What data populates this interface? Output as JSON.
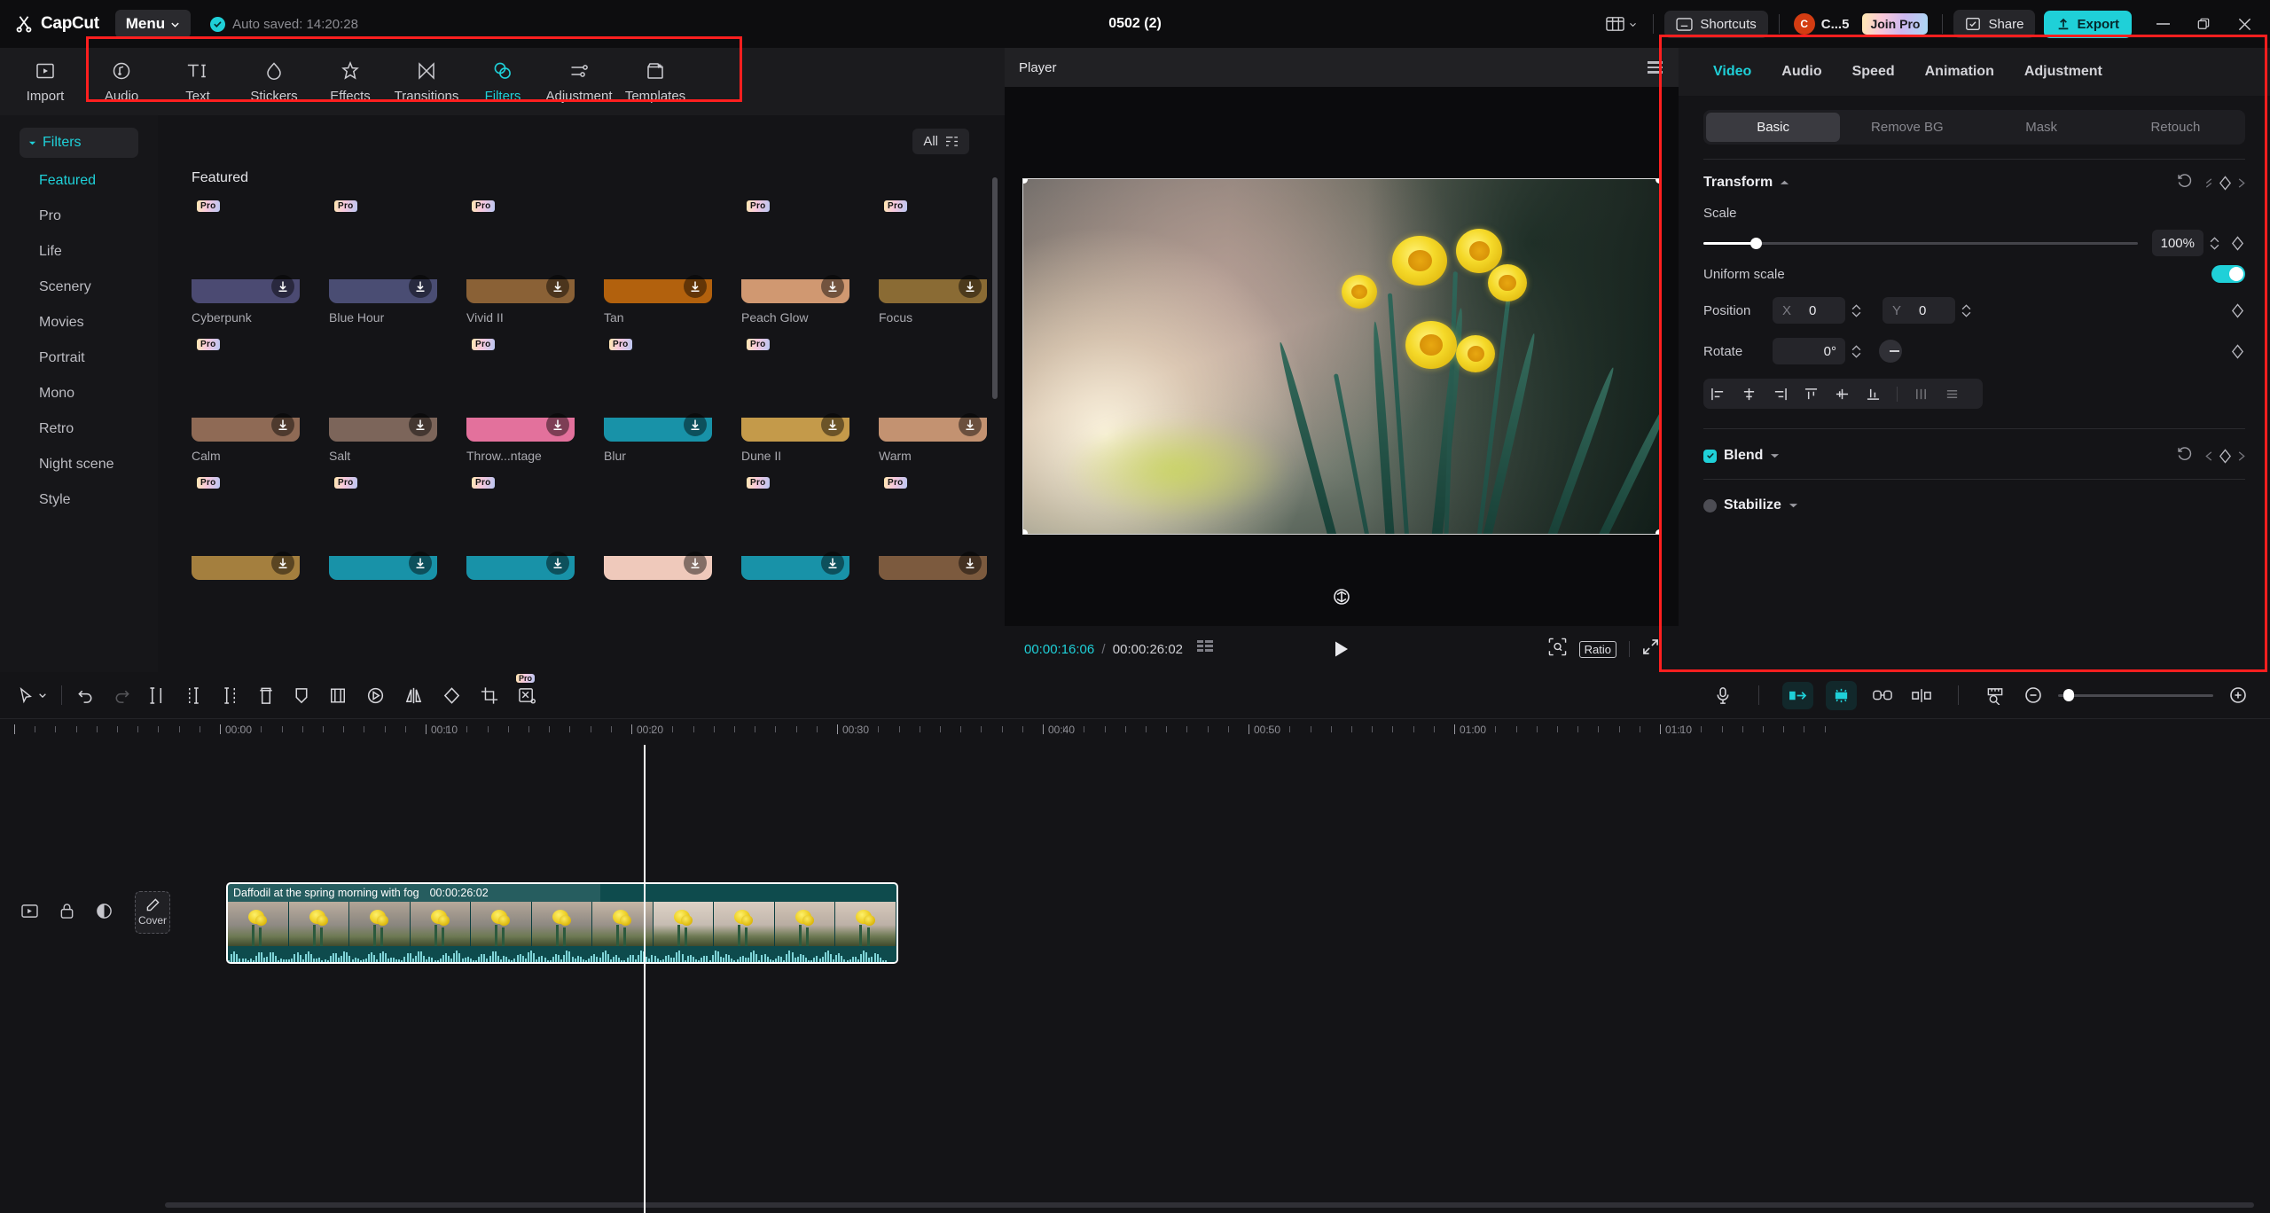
{
  "titlebar": {
    "brand": "CapCut",
    "menu_label": "Menu",
    "autosave_text": "Auto saved: 14:20:28",
    "project_title": "0502 (2)",
    "layout_icon": "layout-icon",
    "shortcuts_label": "Shortcuts",
    "account_initial": "C",
    "account_name": "C...5",
    "join_pro_label": "Join Pro",
    "share_label": "Share",
    "export_label": "Export",
    "window_minimize": "minimize-icon",
    "window_restore": "restore-icon",
    "window_close": "close-icon"
  },
  "function_tabs": [
    {
      "label": "Import",
      "icon": "import-icon",
      "active": false
    },
    {
      "label": "Audio",
      "icon": "audio-note-icon",
      "active": false
    },
    {
      "label": "Text",
      "icon": "text-ti-icon",
      "active": false
    },
    {
      "label": "Stickers",
      "icon": "sticker-drop-icon",
      "active": false
    },
    {
      "label": "Effects",
      "icon": "effects-star-icon",
      "active": false
    },
    {
      "label": "Transitions",
      "icon": "transitions-bowtie-icon",
      "active": false
    },
    {
      "label": "Filters",
      "icon": "filters-circles-icon",
      "active": true
    },
    {
      "label": "Adjustment",
      "icon": "adjustment-sliders-icon",
      "active": false
    },
    {
      "label": "Templates",
      "icon": "templates-icon",
      "active": false
    }
  ],
  "categories": {
    "header": "Filters",
    "items": [
      {
        "label": "Featured",
        "active": true
      },
      {
        "label": "Pro",
        "active": false
      },
      {
        "label": "Life",
        "active": false
      },
      {
        "label": "Scenery",
        "active": false
      },
      {
        "label": "Movies",
        "active": false
      },
      {
        "label": "Portrait",
        "active": false
      },
      {
        "label": "Mono",
        "active": false
      },
      {
        "label": "Retro",
        "active": false
      },
      {
        "label": "Night scene",
        "active": false
      },
      {
        "label": "Style",
        "active": false
      }
    ]
  },
  "filter_panel": {
    "all_label": "All",
    "filter_icon": "filter-sort-icon",
    "section_title": "Featured",
    "pro_badge": "Pro",
    "download_icon": "download-icon",
    "items": [
      {
        "name": "Cyberpunk",
        "pro": true,
        "c1": "#2a1038",
        "c2": "#d11a74",
        "c3": "#7b3fd1",
        "base": "#4b4a72"
      },
      {
        "name": "Blue Hour",
        "pro": true,
        "c1": "#08142e",
        "c2": "#1b4f96",
        "c3": "#3f7fd4",
        "base": "#4a4d73"
      },
      {
        "name": "Vivid II",
        "pro": true,
        "c1": "#1f84e8",
        "c2": "#3fa0f2",
        "c3": "#f0c400",
        "base": "#8a6136"
      },
      {
        "name": "Tan",
        "pro": false,
        "c1": "#f0a81a",
        "c2": "#f5b93a",
        "c3": "#ffffff",
        "base": "#b2610d"
      },
      {
        "name": "Peach Glow",
        "pro": true,
        "c1": "#cbc2bf",
        "c2": "#e8b9a0",
        "c3": "#f3ddd2",
        "base": "#d09871"
      },
      {
        "name": "Focus",
        "pro": true,
        "c1": "#2f6fc0",
        "c2": "#4b8ad6",
        "c3": "#e8c21b",
        "base": "#8a6b34"
      },
      {
        "name": "Calm",
        "pro": true,
        "c1": "#9fb0bc",
        "c2": "#c8d6de",
        "c3": "#eef3f6",
        "base": "#8f6a55"
      },
      {
        "name": "Salt",
        "pro": false,
        "c1": "#c9c9c9",
        "c2": "#e2e0dd",
        "c3": "#8b7557",
        "base": "#7c655a"
      },
      {
        "name": "Throw...ntage",
        "pro": true,
        "c1": "#3c6fa8",
        "c2": "#e0558c",
        "c3": "#f0a6c0",
        "base": "#e3719c"
      },
      {
        "name": "Blur",
        "pro": true,
        "c1": "#cfe3ec",
        "c2": "#f2ead8",
        "c3": "#e0a83c",
        "base": "#1892a8"
      },
      {
        "name": "Dune II",
        "pro": true,
        "c1": "#3d6b70",
        "c2": "#7f9aa0",
        "c3": "#dcc389",
        "base": "#c49a4a"
      },
      {
        "name": "Warm",
        "pro": false,
        "c1": "#35b9d8",
        "c2": "#66d0e6",
        "c3": "#d8a882",
        "base": "#c39271"
      },
      {
        "name": "",
        "pro": true,
        "c1": "#8a7c62",
        "c2": "#c4a878",
        "c3": "#4a4436",
        "base": "#a47f3e"
      },
      {
        "name": "",
        "pro": true,
        "c1": "#2f5fa8",
        "c2": "#bcd2e4",
        "c3": "#d79a5a",
        "base": "#1892a8"
      },
      {
        "name": "",
        "pro": true,
        "c1": "#8fb8cc",
        "c2": "#e6d4c0",
        "c3": "#cf9a5e",
        "base": "#1892a8"
      },
      {
        "name": "",
        "pro": false,
        "c1": "#e7dce4",
        "c2": "#f3e3dc",
        "c3": "#c99a8e",
        "base": "#efc9bb"
      },
      {
        "name": "",
        "pro": true,
        "c1": "#35a8c4",
        "c2": "#d9e6ec",
        "c3": "#d49a60",
        "base": "#1892a8"
      },
      {
        "name": "",
        "pro": true,
        "c1": "#0d2b2a",
        "c2": "#1fb49a",
        "c3": "#d83a2a",
        "base": "#7c5a3e"
      }
    ]
  },
  "player": {
    "title": "Player",
    "menu_icon": "player-menu-icon",
    "current_time": "00:00:16:06",
    "time_separator": "/",
    "total_time": "00:00:26:02",
    "list_icon": "frame-list-icon",
    "play_icon": "play-icon",
    "magnifier_icon": "fit-magnifier-icon",
    "ratio_label": "Ratio",
    "fullscreen_icon": "fullscreen-icon",
    "rotate_icon": "rotate-icon"
  },
  "inspector": {
    "tabs": [
      {
        "label": "Video",
        "active": true
      },
      {
        "label": "Audio",
        "active": false
      },
      {
        "label": "Speed",
        "active": false
      },
      {
        "label": "Animation",
        "active": false
      },
      {
        "label": "Adjustment",
        "active": false
      }
    ],
    "segments": [
      {
        "label": "Basic",
        "active": true
      },
      {
        "label": "Remove BG",
        "active": false
      },
      {
        "label": "Mask",
        "active": false
      },
      {
        "label": "Retouch",
        "active": false
      }
    ],
    "transform": {
      "title": "Transform",
      "reset_icon": "reset-icon",
      "keyframe_icon": "keyframe-diamond-icon",
      "scale_label": "Scale",
      "scale_value": "100%",
      "scale_percent": 12,
      "uniform_label": "Uniform scale",
      "uniform_on": true,
      "position_label": "Position",
      "position_x_axis": "X",
      "position_x": "0",
      "position_y_axis": "Y",
      "position_y": "0",
      "rotate_label": "Rotate",
      "rotate_value": "0°",
      "align_icons": [
        "align-left-icon",
        "align-center-h-icon",
        "align-right-icon",
        "align-top-icon",
        "align-middle-v-icon",
        "align-bottom-icon",
        "distribute-h-icon",
        "distribute-v-icon"
      ]
    },
    "blend": {
      "label": "Blend",
      "checked": true
    },
    "stabilize": {
      "label": "Stabilize",
      "checked": false
    }
  },
  "timeline": {
    "toolbar_left": [
      {
        "icon": "select-arrow-icon",
        "disabled": false
      },
      {
        "icon": "chevron-down-icon",
        "disabled": false
      },
      {
        "icon": "undo-icon",
        "disabled": false
      },
      {
        "icon": "redo-icon",
        "disabled": true
      },
      {
        "icon": "split-icon",
        "disabled": false
      },
      {
        "icon": "trim-start-icon",
        "disabled": false
      },
      {
        "icon": "trim-end-icon",
        "disabled": false
      },
      {
        "icon": "delete-icon",
        "disabled": false
      },
      {
        "icon": "marker-icon",
        "disabled": false
      },
      {
        "icon": "freeze-frame-icon",
        "disabled": false
      },
      {
        "icon": "reverse-icon",
        "disabled": false
      },
      {
        "icon": "mirror-icon",
        "disabled": false
      },
      {
        "icon": "rotate-clip-icon",
        "disabled": false
      },
      {
        "icon": "crop-icon",
        "disabled": false
      },
      {
        "icon": "auto-cut-icon",
        "disabled": false,
        "pro": "Pro"
      }
    ],
    "toolbar_right": [
      {
        "icon": "microphone-icon",
        "active": false
      },
      {
        "icon": "snap-magnet-icon",
        "active": true
      },
      {
        "icon": "adsorb-icon",
        "active": true
      },
      {
        "icon": "link-icon",
        "active": false
      },
      {
        "icon": "split-view-icon",
        "active": false
      },
      {
        "icon": "ruler-zoom-icon",
        "active": false
      },
      {
        "icon": "zoom-out-icon",
        "active": false
      },
      {
        "icon": "zoom-in-icon",
        "active": false
      }
    ],
    "ruler_labels": [
      "00:00",
      "00:10",
      "00:20",
      "00:30",
      "00:40",
      "00:50",
      "01:00",
      "01:10"
    ],
    "track_controls": [
      {
        "icon": "thumbnail-toggle-icon"
      },
      {
        "icon": "lock-icon"
      },
      {
        "icon": "visibility-icon"
      },
      {
        "icon": "speaker-icon"
      }
    ],
    "cover_label": "Cover",
    "cover_icon": "pencil-icon",
    "clip": {
      "name": "Daffodil at the spring morning with fog",
      "duration": "00:00:26:02"
    }
  }
}
